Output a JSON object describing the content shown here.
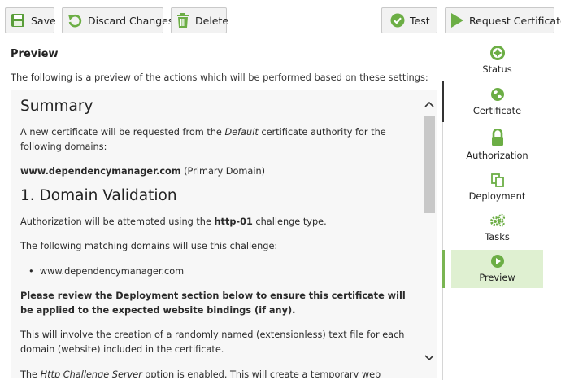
{
  "toolbar": {
    "save_label": "Save",
    "discard_label": "Discard Changes",
    "delete_label": "Delete",
    "test_label": "Test",
    "request_label": "Request Certificate"
  },
  "preview": {
    "heading": "Preview",
    "intro": "The following is a preview of the actions which will be performed based on these settings:"
  },
  "content": {
    "summary_heading": "Summary",
    "summary_text_pre": "A new certificate will be requested from the ",
    "summary_text_em": "Default",
    "summary_text_post": " certificate authority for the following domains:",
    "domain_strong": "www.dependencymanager.com",
    "domain_note": " (Primary Domain)",
    "validation_heading": "1. Domain Validation",
    "auth_pre": "Authorization will be attempted using the ",
    "auth_strong": "http-01",
    "auth_post": " challenge type.",
    "matching_text": "The following matching domains will use this challenge:",
    "bullet_domain": "www.dependencymanager.com",
    "review_strong": "Please review the Deployment section below to ensure this certificate will be applied to the expected website bindings (if any).",
    "creation_text": "This will involve the creation of a randomly named (extensionless) text file for each domain (website) included in the certificate.",
    "http_pre": "The ",
    "http_em": "Http Challenge Server",
    "http_post": " option is enabled. This will create a temporary web service on"
  },
  "nav": {
    "items": [
      {
        "label": "Status",
        "icon": "status-icon"
      },
      {
        "label": "Certificate",
        "icon": "globe-icon"
      },
      {
        "label": "Authorization",
        "icon": "lock-icon"
      },
      {
        "label": "Deployment",
        "icon": "copy-icon"
      },
      {
        "label": "Tasks",
        "icon": "gears-icon"
      },
      {
        "label": "Preview",
        "icon": "play-icon"
      }
    ],
    "active": "Preview"
  },
  "colors": {
    "accent_green": "#7ab552",
    "active_bg": "#dff0d1",
    "delete_icon": "#6cae45"
  }
}
